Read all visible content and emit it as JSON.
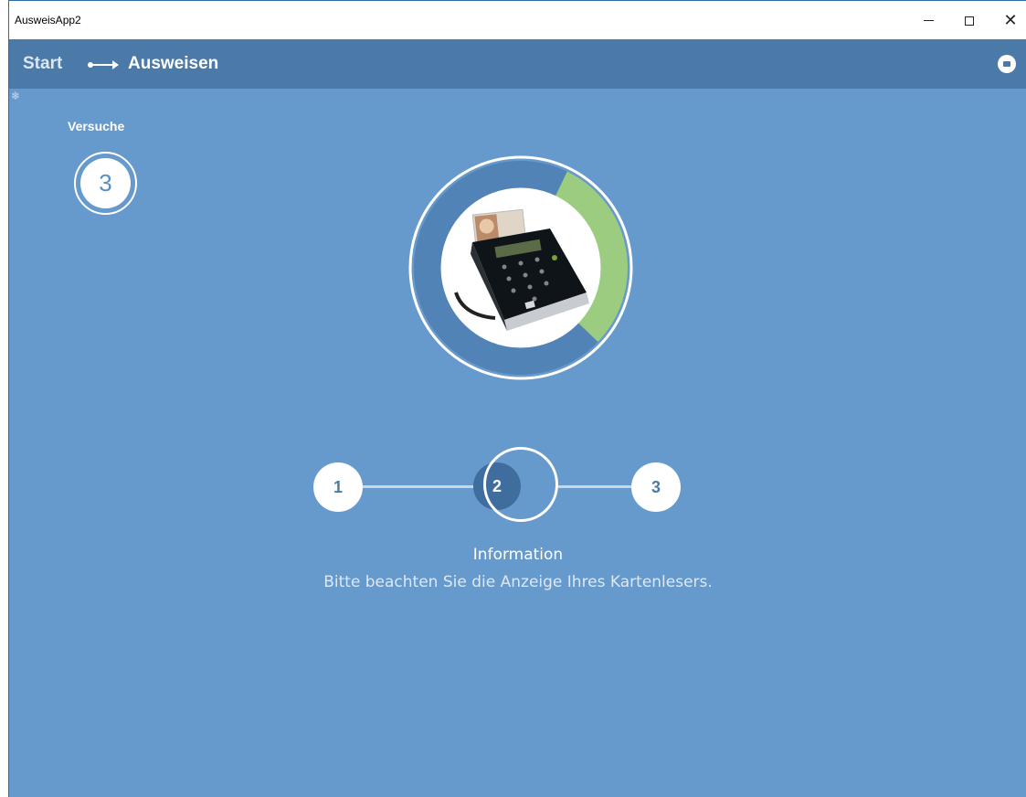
{
  "window": {
    "title": "AusweisApp2"
  },
  "header": {
    "breadcrumb_start": "Start",
    "breadcrumb_current": "Ausweisen",
    "cancel_icon": "cancel-icon"
  },
  "attempts": {
    "label": "Versuche",
    "value": "3"
  },
  "reader": {
    "progress_fraction": 0.3,
    "accent_color": "#9ccc7f",
    "track_color": "#5283b6"
  },
  "steps": {
    "items": [
      {
        "number": "1"
      },
      {
        "number": "2"
      },
      {
        "number": "3"
      }
    ],
    "active": 2
  },
  "info": {
    "title": "Information",
    "text": "Bitte beachten Sie die Anzeige Ihres Kartenlesers."
  },
  "colors": {
    "background": "#6699cc",
    "header": "#4c7aa8"
  }
}
